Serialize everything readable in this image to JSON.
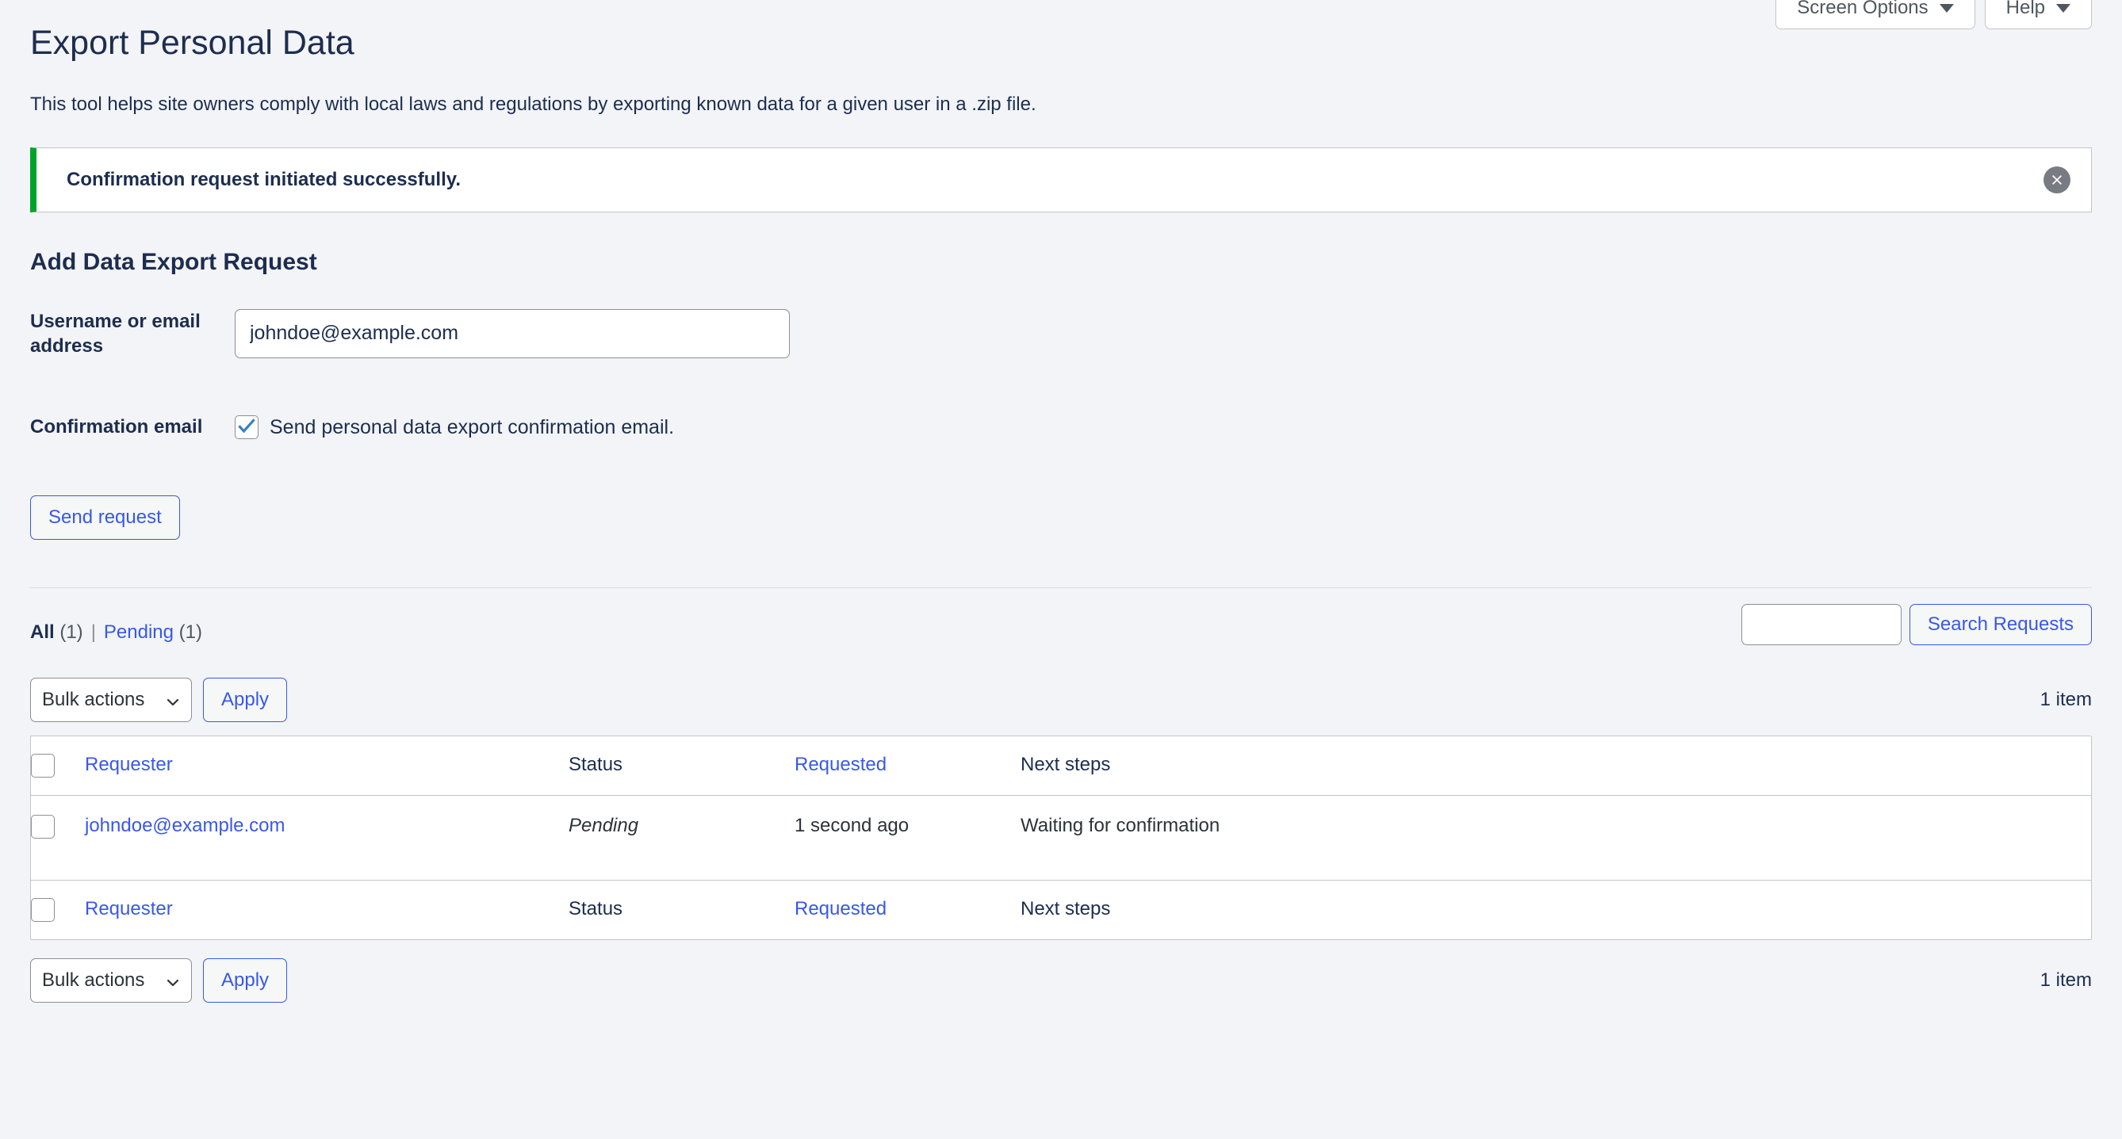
{
  "screen_meta": {
    "screen_options_label": "Screen Options",
    "help_label": "Help"
  },
  "header": {
    "title": "Export Personal Data",
    "intro": "This tool helps site owners comply with local laws and regulations by exporting known data for a given user in a .zip file."
  },
  "notice": {
    "message": "Confirmation request initiated successfully.",
    "accent_color": "#00a32a",
    "dismiss_icon": "close-circle-icon"
  },
  "form": {
    "section_title": "Add Data Export Request",
    "username_label": "Username or email address",
    "username_value": "johndoe@example.com",
    "username_placeholder": "",
    "confirmation_label": "Confirmation email",
    "confirmation_checkbox_label": "Send personal data export confirmation email.",
    "confirmation_checked": true,
    "submit_label": "Send request"
  },
  "filters": {
    "all_label": "All",
    "all_count": "(1)",
    "separator": "|",
    "pending_label": "Pending",
    "pending_count": "(1)"
  },
  "search": {
    "value": "",
    "placeholder": "",
    "button_label": "Search Requests"
  },
  "tablenav_top": {
    "bulk_selected": "Bulk actions",
    "bulk_options": [
      "Bulk actions"
    ],
    "apply_label": "Apply",
    "count_label": "1 item"
  },
  "tablenav_bottom": {
    "bulk_selected": "Bulk actions",
    "bulk_options": [
      "Bulk actions"
    ],
    "apply_label": "Apply",
    "count_label": "1 item"
  },
  "table": {
    "columns": {
      "requester": "Requester",
      "status": "Status",
      "requested": "Requested",
      "next_steps": "Next steps"
    },
    "rows": [
      {
        "requester": "johndoe@example.com",
        "status": "Pending",
        "requested": "1 second ago",
        "next_steps": "Waiting for confirmation"
      }
    ]
  },
  "colors": {
    "link": "#3858e9",
    "heading": "#1d2d4f",
    "page_bg": "#f2f4f7",
    "success": "#00a32a"
  }
}
